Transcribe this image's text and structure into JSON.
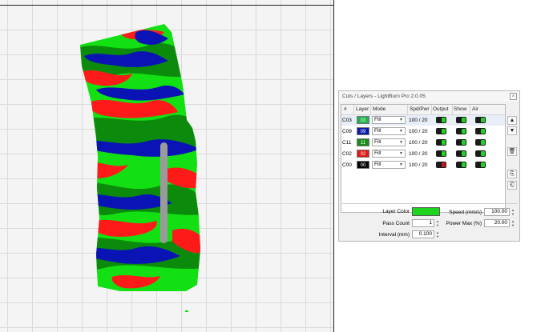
{
  "panel": {
    "title": "Cuts / Layers - LightBurn Pro 2.0.05",
    "close_label": "×",
    "columns": [
      "#",
      "Layer",
      "Mode",
      "Spd/Pwr",
      "Output",
      "Show",
      "Air"
    ],
    "layers": [
      {
        "id": "C03",
        "num": "03",
        "color": "#1fb24a",
        "mode": "Fill",
        "spd_pwr": "100 / 20",
        "output": true,
        "show": true,
        "air": true
      },
      {
        "id": "C09",
        "num": "09",
        "color": "#0a1aa8",
        "mode": "Fill",
        "spd_pwr": "100 / 20",
        "output": true,
        "show": true,
        "air": true
      },
      {
        "id": "C11",
        "num": "11",
        "color": "#1a8a1a",
        "mode": "Fill",
        "spd_pwr": "100 / 20",
        "output": true,
        "show": true,
        "air": true
      },
      {
        "id": "C02",
        "num": "02",
        "color": "#e01818",
        "mode": "Fill",
        "spd_pwr": "100 / 20",
        "output": true,
        "show": true,
        "air": true
      },
      {
        "id": "C00",
        "num": "00",
        "color": "#000000",
        "mode": "Fill",
        "spd_pwr": "100 / 20",
        "output": false,
        "show": true,
        "air": true
      }
    ],
    "side_buttons": [
      "▲",
      "▼",
      "🗑",
      "⎘",
      "⎗"
    ],
    "properties": {
      "layer_color_label": "Layer Color",
      "layer_color_value": "#1fd41f",
      "pass_count_label": "Pass Count",
      "pass_count_value": "1",
      "interval_label": "Interval (mm)",
      "interval_value": "0.100",
      "speed_label": "Speed (mm/s)",
      "speed_value": "100.00",
      "power_max_label": "Power Max (%)",
      "power_max_value": "20.00"
    }
  },
  "colors": {
    "camo_red": "#ff1a1a",
    "camo_blue": "#0a14b4",
    "camo_light_green": "#12e012",
    "camo_dark_green": "#0c8a0c",
    "handle_gray": "#9a9a9a"
  }
}
